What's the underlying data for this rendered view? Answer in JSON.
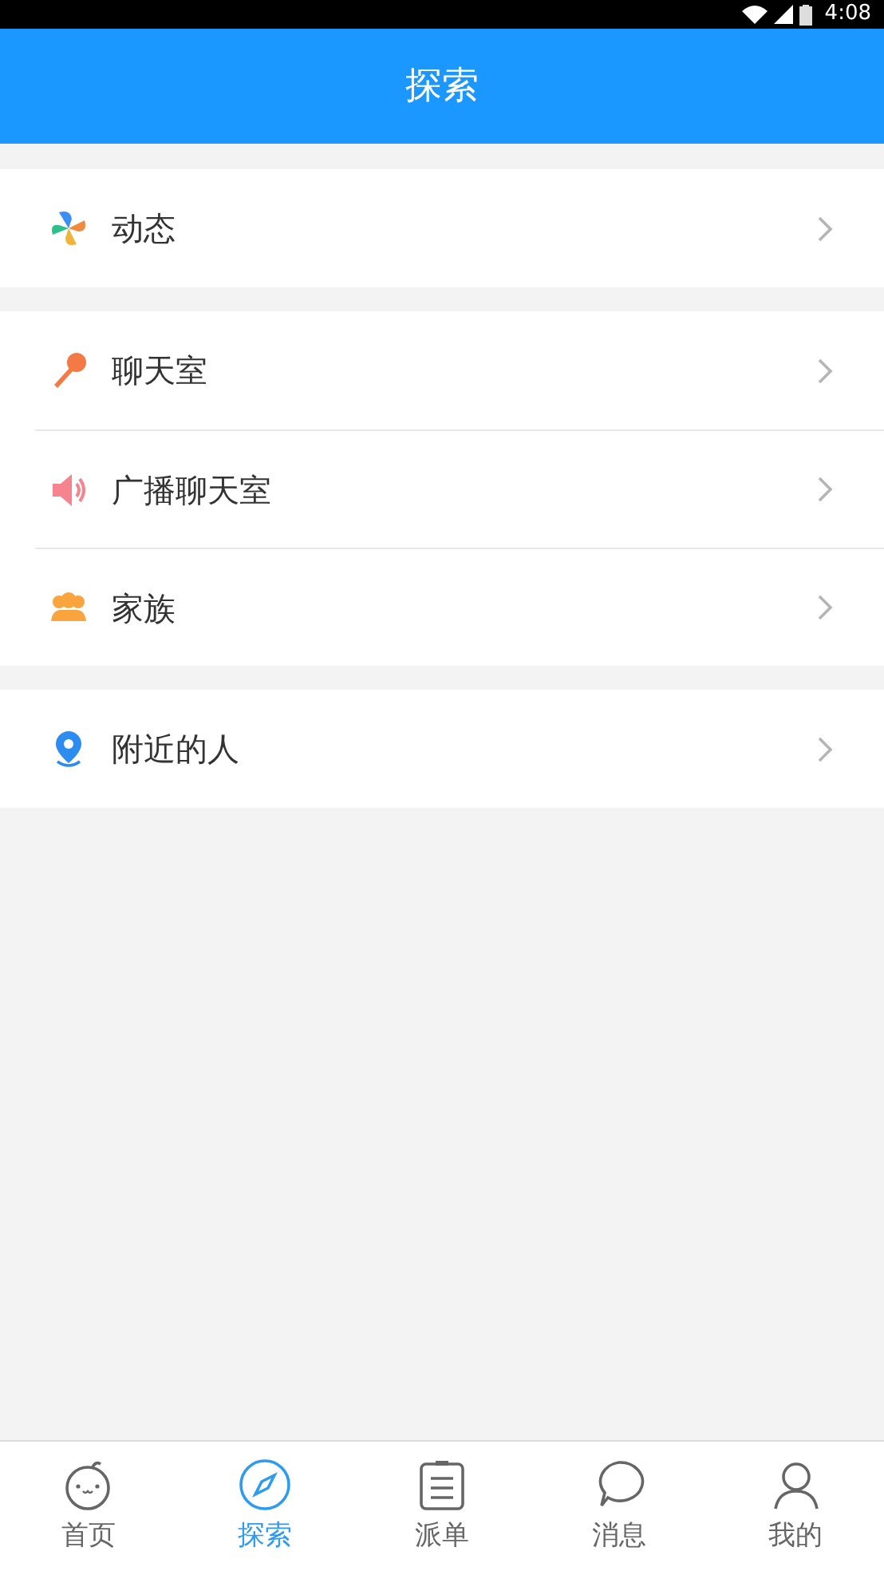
{
  "status_bar": {
    "time": "4:08"
  },
  "header": {
    "title": "探索"
  },
  "groups": [
    {
      "items": [
        {
          "label": "动态"
        }
      ]
    },
    {
      "items": [
        {
          "label": "聊天室"
        },
        {
          "label": "广播聊天室"
        },
        {
          "label": "家族"
        }
      ]
    },
    {
      "items": [
        {
          "label": "附近的人"
        }
      ]
    }
  ],
  "tabs": [
    {
      "label": "首页",
      "selected": false
    },
    {
      "label": "探索",
      "selected": true
    },
    {
      "label": "派单",
      "selected": false
    },
    {
      "label": "消息",
      "selected": false
    },
    {
      "label": "我的",
      "selected": false
    }
  ]
}
